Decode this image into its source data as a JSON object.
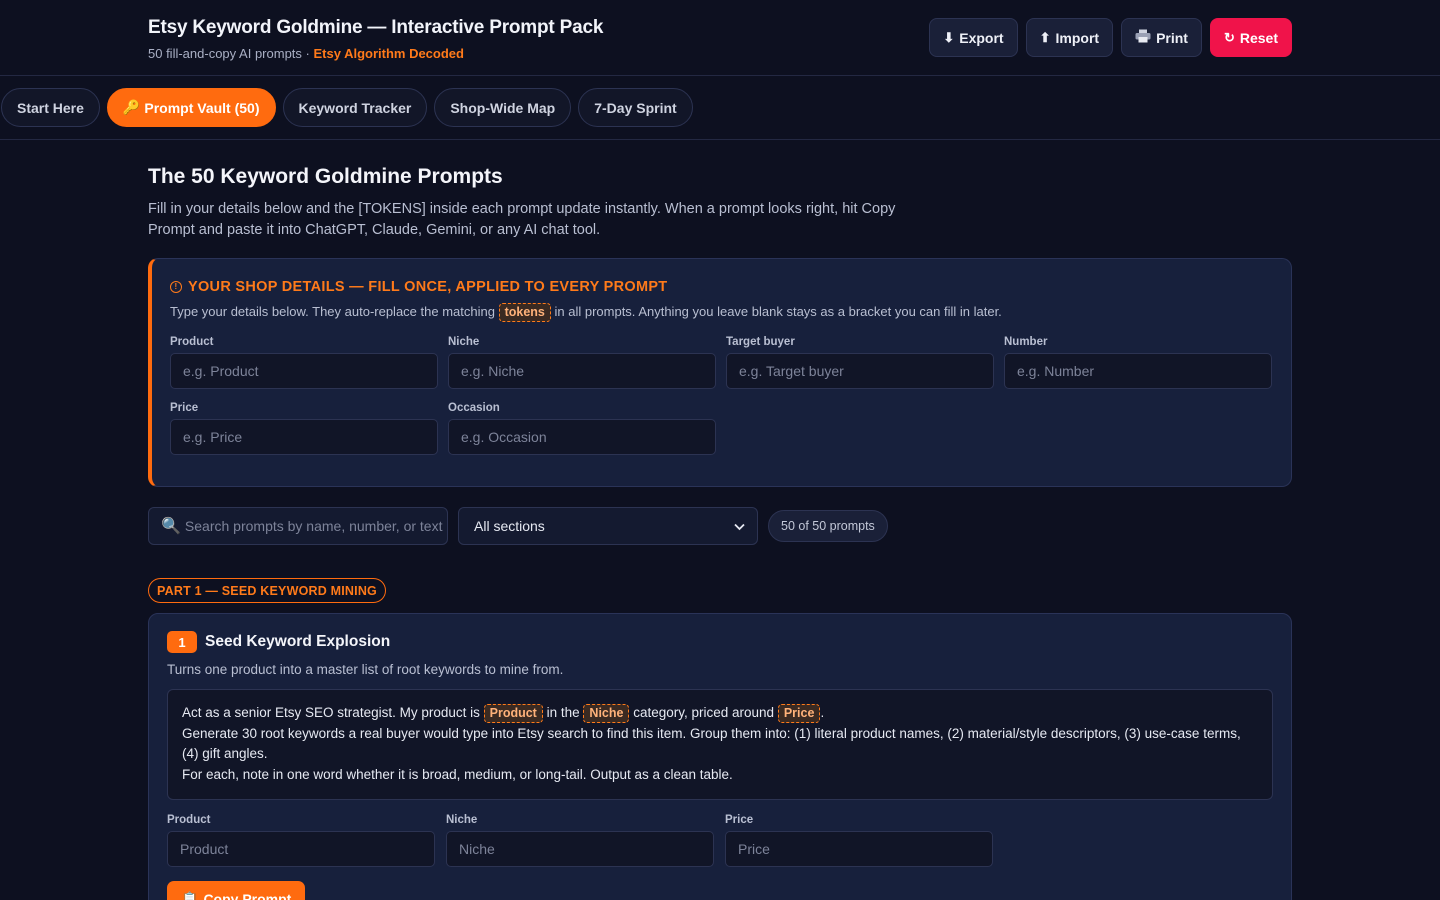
{
  "header": {
    "title": "Etsy Keyword Goldmine — Interactive Prompt Pack",
    "subtitle": "50 fill-and-copy AI prompts ·",
    "subtitle_accent": "Etsy Algorithm Decoded",
    "buttons": {
      "export": "Export",
      "import": "Import",
      "print": "Print",
      "reset": "Reset"
    }
  },
  "tabs": [
    {
      "label": "Start Here"
    },
    {
      "label": "Prompt Vault (50)"
    },
    {
      "label": "Keyword Tracker"
    },
    {
      "label": "Shop-Wide Map"
    },
    {
      "label": "7-Day Sprint"
    }
  ],
  "main": {
    "title": "The 50 Keyword Goldmine Prompts",
    "description": "Fill in your details below and the [TOKENS] inside each prompt update instantly. When a prompt looks right, hit Copy Prompt and paste it into ChatGPT, Claude, Gemini, or any AI chat tool."
  },
  "details": {
    "heading": "YOUR SHOP DETAILS — FILL ONCE, APPLIED TO EVERY PROMPT",
    "note_before": "Type your details below. They auto-replace the matching",
    "note_token": "tokens",
    "note_after": "in all prompts. Anything you leave blank stays as a bracket you can fill in later.",
    "fields": [
      {
        "label": "Product",
        "placeholder": "e.g. Product"
      },
      {
        "label": "Niche",
        "placeholder": "e.g. Niche"
      },
      {
        "label": "Target buyer",
        "placeholder": "e.g. Target buyer"
      },
      {
        "label": "Number",
        "placeholder": "e.g. Number"
      },
      {
        "label": "Price",
        "placeholder": "e.g. Price"
      },
      {
        "label": "Occasion",
        "placeholder": "e.g. Occasion"
      }
    ]
  },
  "filters": {
    "search_placeholder": "Search prompts by name, number, or text",
    "section_select": "All sections",
    "count": "50 of 50 prompts"
  },
  "section": {
    "label": "PART 1 — SEED KEYWORD MINING"
  },
  "prompt_card": {
    "number": "1",
    "title": "Seed Keyword Explosion",
    "description": "Turns one product into a master list of root keywords to mine from.",
    "line1_a": "Act as a senior Etsy SEO strategist. My product is",
    "token_product": "Product",
    "line1_b": "in the",
    "token_niche": "Niche",
    "line1_c": "category, priced around",
    "token_price": "Price",
    "line1_d": ".",
    "line2": "Generate 30 root keywords a real buyer would type into Etsy search to find this item. Group them into: (1) literal product names, (2) material/style descriptors, (3) use-case terms, (4) gift angles.",
    "line3": "For each, note in one word whether it is broad, medium, or long-tail. Output as a clean table.",
    "fields": [
      {
        "label": "Product",
        "placeholder": "Product"
      },
      {
        "label": "Niche",
        "placeholder": "Niche"
      },
      {
        "label": "Price",
        "placeholder": "Price"
      }
    ],
    "copy_label": "Copy Prompt"
  },
  "colors": {
    "accent": "#ff6b0f",
    "danger": "#f0134a",
    "background": "#0d1020",
    "card": "#17203c"
  }
}
